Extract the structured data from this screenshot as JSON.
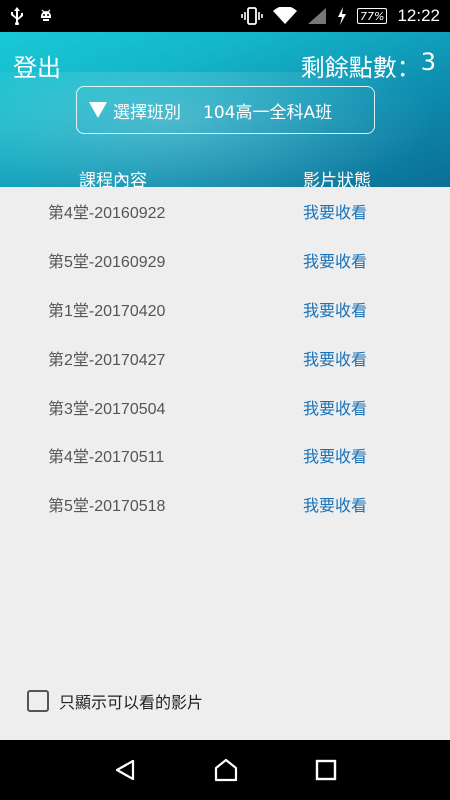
{
  "status_bar": {
    "icons": [
      "usb-icon",
      "android-debug-icon",
      "vibrate-icon",
      "wifi-icon",
      "signal-icon",
      "charging-icon"
    ],
    "battery": "77%",
    "time": "12:22"
  },
  "header": {
    "logout_label": "登出",
    "points_label": "剩餘點數：",
    "points_value": "3",
    "class_select": {
      "label": "選擇班別",
      "value": "104高一全科A班"
    },
    "columns": {
      "course": "課程內容",
      "status": "影片狀態"
    }
  },
  "rows": [
    {
      "course": "第4堂-20160922",
      "status": "我要收看"
    },
    {
      "course": "第5堂-20160929",
      "status": "我要收看"
    },
    {
      "course": "第1堂-20170420",
      "status": "我要收看"
    },
    {
      "course": "第2堂-20170427",
      "status": "我要收看"
    },
    {
      "course": "第3堂-20170504",
      "status": "我要收看"
    },
    {
      "course": "第4堂-20170511",
      "status": "我要收看"
    },
    {
      "course": "第5堂-20170518",
      "status": "我要收看"
    }
  ],
  "filter": {
    "label": "只顯示可以看的影片",
    "checked": false
  },
  "nav": [
    "back-icon",
    "home-icon",
    "recents-icon"
  ],
  "colors": {
    "header_start": "#19c9d6",
    "header_end": "#0b6e95",
    "link": "#1a73b9",
    "background": "#eeeeee"
  }
}
